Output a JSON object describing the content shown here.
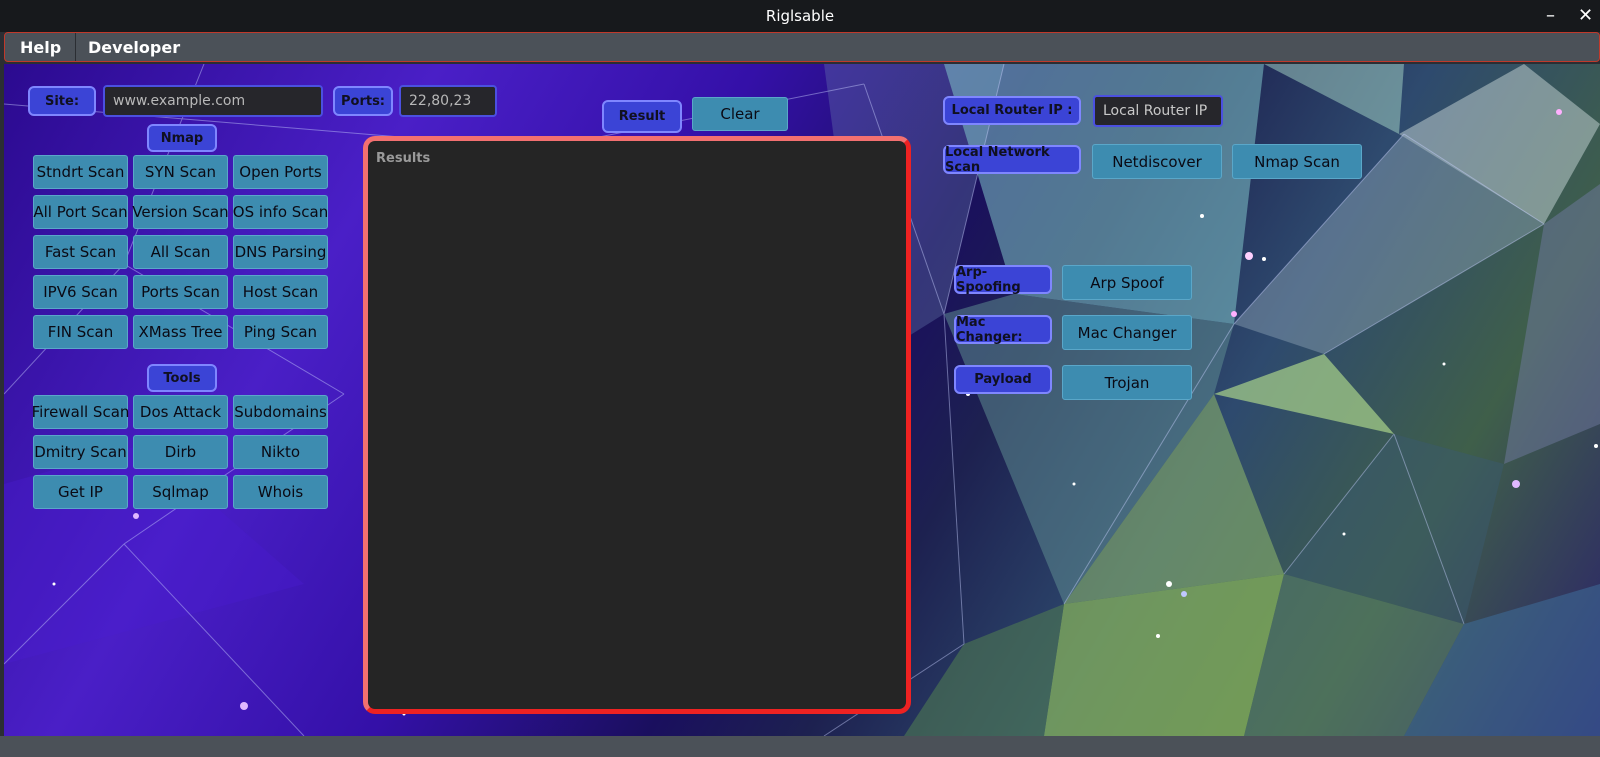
{
  "window": {
    "title": "Riglsable",
    "minimize": "–",
    "close": "✕"
  },
  "menu": {
    "help": "Help",
    "developer": "Developer"
  },
  "inputs": {
    "site_label": "Site:",
    "site_placeholder": "www.example.com",
    "ports_label": "Ports:",
    "ports_value": "22,80,23"
  },
  "nmap": {
    "header": "Nmap",
    "buttons": [
      "Stndrt Scan",
      "SYN Scan",
      "Open Ports",
      "All Port Scan",
      "Version Scan",
      "OS info Scan",
      "Fast Scan",
      "All Scan",
      "DNS Parsing",
      "IPV6 Scan",
      "Ports Scan",
      "Host Scan",
      "FIN Scan",
      "XMass Tree",
      "Ping Scan"
    ]
  },
  "tools": {
    "header": "Tools",
    "buttons": [
      "Firewall Scan",
      "Dos Attack",
      "Subdomains",
      "Dmitry Scan",
      "Dirb",
      "Nikto",
      "Get IP",
      "Sqlmap",
      "Whois"
    ]
  },
  "result_bar": {
    "result_label": "Result",
    "clear": "Clear"
  },
  "results": {
    "title": "Results"
  },
  "network": {
    "router_label": "Local Router IP :",
    "router_placeholder": "Local Router IP",
    "scan_label": "Local Network Scan",
    "netdiscover": "Netdiscover",
    "nmap_scan": "Nmap Scan"
  },
  "attacks": {
    "arp_label": "Arp-Spoofing",
    "arp_button": "Arp Spoof",
    "mac_label": "Mac Changer:",
    "mac_button": "Mac Changer",
    "payload_label": "Payload",
    "trojan_button": "Trojan"
  },
  "colors": {
    "button_bg": "#3d8cb0",
    "label_bg": "#3b44d6",
    "results_border": "#ee2222",
    "titlebar": "#17191c"
  }
}
